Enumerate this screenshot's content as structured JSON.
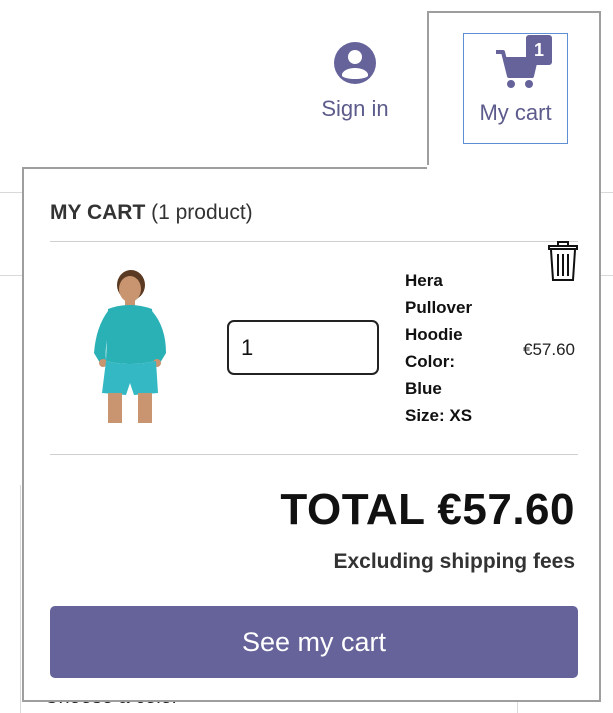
{
  "header": {
    "sign_in_label": "Sign in",
    "cart_label": "My cart",
    "cart_count": "1"
  },
  "minicart": {
    "title_bold": "MY CART",
    "title_count": "(1 product)",
    "items": [
      {
        "name_line1": "Hera",
        "name_line2": "Pullover",
        "name_line3": "Hoodie",
        "color_label": "Color:",
        "color_value": "Blue",
        "size": "Size: XS",
        "quantity": "1",
        "price": "€57.60"
      }
    ],
    "total": "TOTAL €57.60",
    "shipping_note": "Excluding shipping fees",
    "see_cart_label": "See my cart"
  },
  "background": {
    "partial_text": "Choose a color"
  },
  "colors": {
    "accent": "#65639a",
    "focus_border": "#5d8fd5",
    "panel_border": "#9e9e9e"
  },
  "icons": [
    "user-icon",
    "cart-icon",
    "trash-icon"
  ]
}
